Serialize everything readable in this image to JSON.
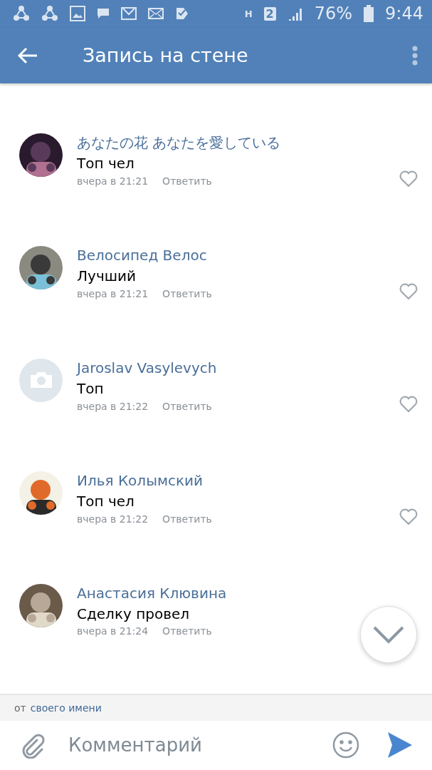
{
  "status_bar": {
    "network": "H",
    "sim": "2",
    "battery": "76%",
    "time": "9:44"
  },
  "app_bar": {
    "title": "Запись на стене"
  },
  "comments": [
    {
      "author": "あなたの花 あなたを愛している",
      "text": "Топ чел",
      "time": "вчера в 21:21",
      "reply": "Ответить",
      "liked": false
    },
    {
      "author": "Велосипед Велос",
      "text": "Лучший",
      "time": "вчера в 21:21",
      "reply": "Ответить",
      "liked": false
    },
    {
      "author": "Jaroslav Vasylevych",
      "text": "Топ",
      "time": "вчера в 21:22",
      "reply": "Ответить",
      "avatar": {
        "kind": "placeholder"
      },
      "liked": false
    },
    {
      "author": "Илья Колымский",
      "text": "Топ чел",
      "time": "вчера в 21:22",
      "reply": "Ответить",
      "liked": false
    },
    {
      "author": "Анастасия Клювина",
      "text": "Сделку провел",
      "time": "вчера в 21:24",
      "reply": "Ответить"
    }
  ],
  "sender": {
    "prefix": "от",
    "link": "своего имени"
  },
  "composer": {
    "placeholder": "Комментарий"
  }
}
